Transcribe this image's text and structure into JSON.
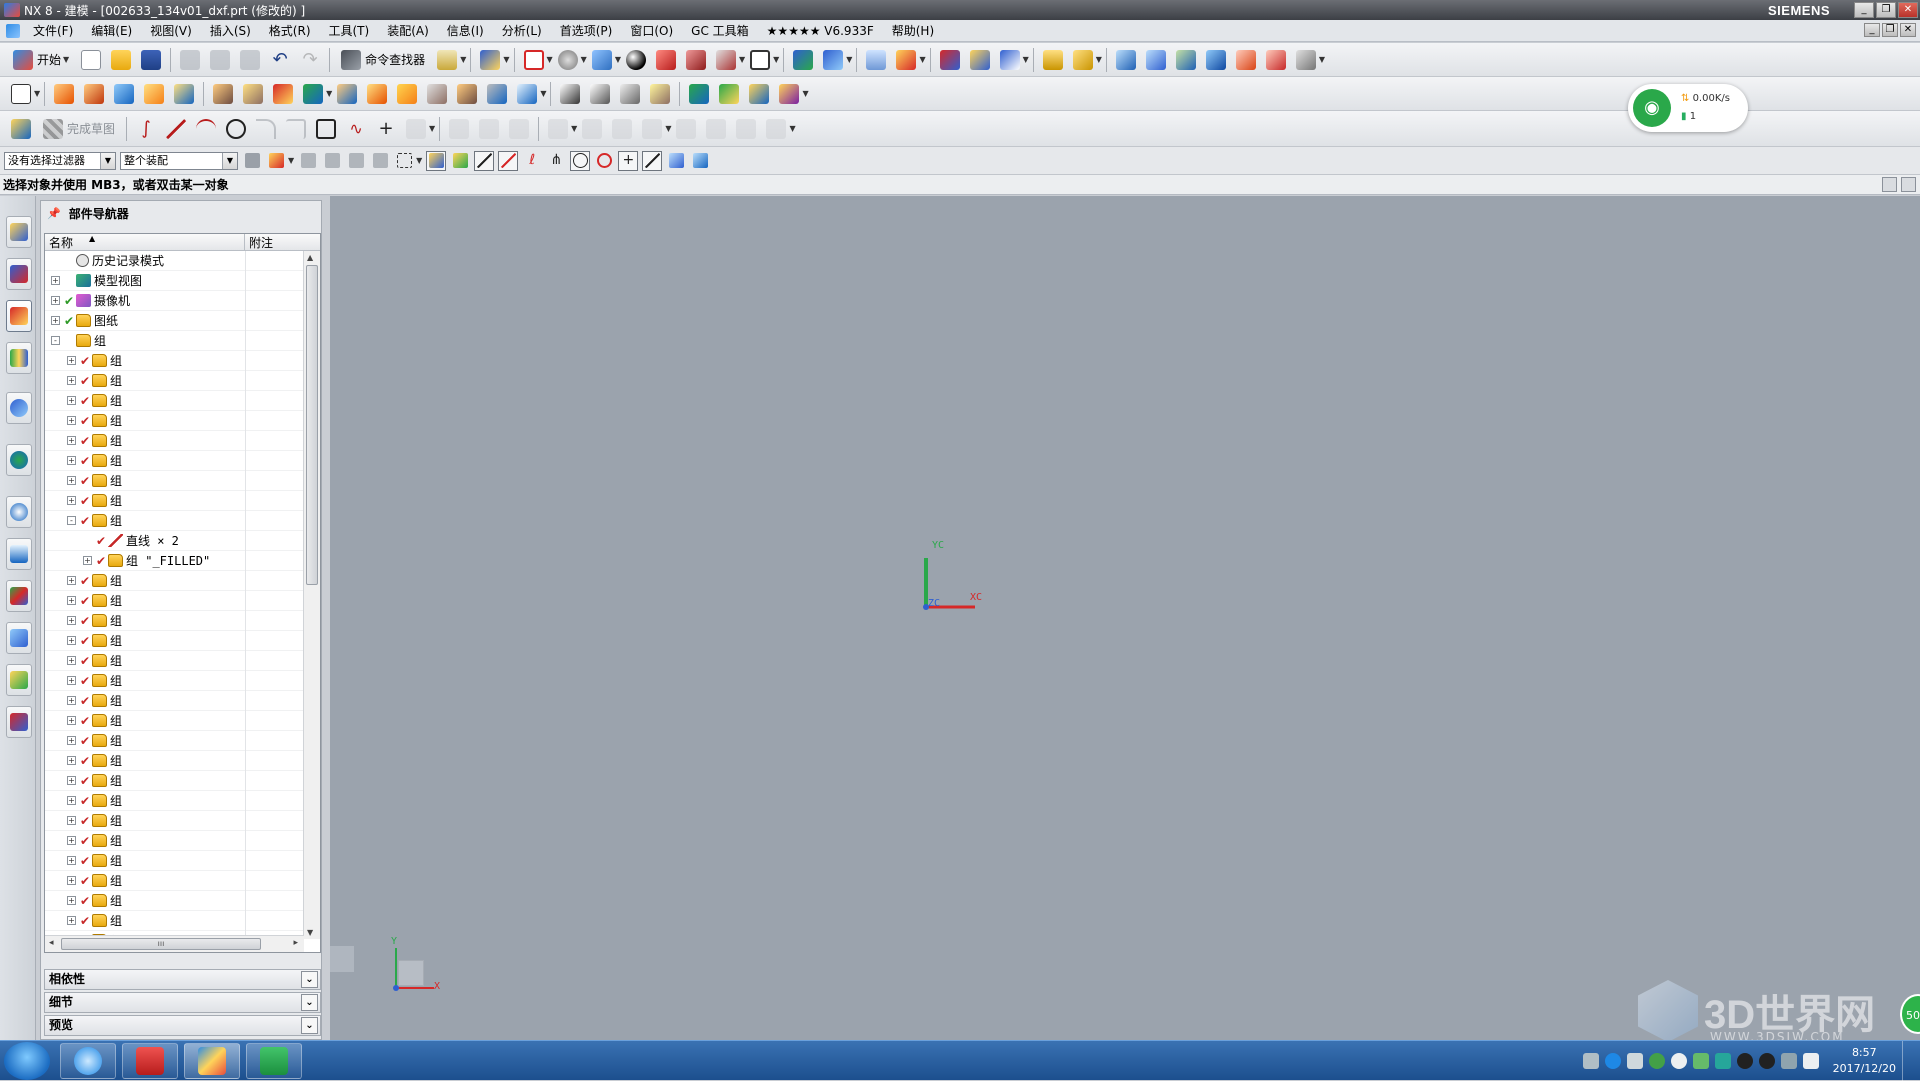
{
  "window": {
    "title": "NX 8 - 建模 - [002633_134v01_dxf.prt (修改的) ]",
    "brand": "SIEMENS",
    "min": "_",
    "restore": "❐",
    "close": "✕"
  },
  "menubar": {
    "items": [
      "文件(F)",
      "编辑(E)",
      "视图(V)",
      "插入(S)",
      "格式(R)",
      "工具(T)",
      "装配(A)",
      "信息(I)",
      "分析(L)",
      "首选项(P)",
      "窗口(O)",
      "GC 工具箱",
      "★★★★★ V6.933F",
      "帮助(H)"
    ]
  },
  "toolbar": {
    "start_label": "开始",
    "command_finder_label": "命令查找器",
    "finish_sketch_label": "完成草图"
  },
  "selection": {
    "filter_value": "没有选择过滤器",
    "scope_value": "整个装配"
  },
  "status": {
    "prompt": "选择对象并使用 MB3，或者双击某一对象"
  },
  "navigator": {
    "title": "部件导航器",
    "col_name": "名称",
    "col_note": "附注",
    "rows": [
      {
        "level": 0,
        "expander": "",
        "check": "",
        "icon": "clock",
        "label": "历史记录模式"
      },
      {
        "level": 0,
        "expander": "+",
        "check": "",
        "icon": "modelview",
        "label": "模型视图"
      },
      {
        "level": 0,
        "expander": "+",
        "check": "✔",
        "icon": "camera",
        "label": "摄像机"
      },
      {
        "level": 0,
        "expander": "+",
        "check": "✔",
        "icon": "folder",
        "label": "图纸"
      },
      {
        "level": 0,
        "expander": "-",
        "check": "",
        "icon": "folder",
        "label": "组"
      },
      {
        "level": 1,
        "expander": "+",
        "check": "✔",
        "icon": "folder",
        "label": "组"
      },
      {
        "level": 1,
        "expander": "+",
        "check": "✔",
        "icon": "folder",
        "label": "组"
      },
      {
        "level": 1,
        "expander": "+",
        "check": "✔",
        "icon": "folder",
        "label": "组"
      },
      {
        "level": 1,
        "expander": "+",
        "check": "✔",
        "icon": "folder",
        "label": "组"
      },
      {
        "level": 1,
        "expander": "+",
        "check": "✔",
        "icon": "folder",
        "label": "组"
      },
      {
        "level": 1,
        "expander": "+",
        "check": "✔",
        "icon": "folder",
        "label": "组"
      },
      {
        "level": 1,
        "expander": "+",
        "check": "✔",
        "icon": "folder",
        "label": "组"
      },
      {
        "level": 1,
        "expander": "+",
        "check": "✔",
        "icon": "folder",
        "label": "组"
      },
      {
        "level": 1,
        "expander": "-",
        "check": "✔",
        "icon": "folder",
        "label": "组"
      },
      {
        "level": 2,
        "expander": "",
        "check": "✔",
        "icon": "line",
        "label": "直线 × 2"
      },
      {
        "level": 2,
        "expander": "+",
        "check": "✔",
        "icon": "folder",
        "label": "组 \"_FILLED\""
      },
      {
        "level": 1,
        "expander": "+",
        "check": "✔",
        "icon": "folder",
        "label": "组"
      },
      {
        "level": 1,
        "expander": "+",
        "check": "✔",
        "icon": "folder",
        "label": "组"
      },
      {
        "level": 1,
        "expander": "+",
        "check": "✔",
        "icon": "folder",
        "label": "组"
      },
      {
        "level": 1,
        "expander": "+",
        "check": "✔",
        "icon": "folder",
        "label": "组"
      },
      {
        "level": 1,
        "expander": "+",
        "check": "✔",
        "icon": "folder",
        "label": "组"
      },
      {
        "level": 1,
        "expander": "+",
        "check": "✔",
        "icon": "folder",
        "label": "组"
      },
      {
        "level": 1,
        "expander": "+",
        "check": "✔",
        "icon": "folder",
        "label": "组"
      },
      {
        "level": 1,
        "expander": "+",
        "check": "✔",
        "icon": "folder",
        "label": "组"
      },
      {
        "level": 1,
        "expander": "+",
        "check": "✔",
        "icon": "folder",
        "label": "组"
      },
      {
        "level": 1,
        "expander": "+",
        "check": "✔",
        "icon": "folder",
        "label": "组"
      },
      {
        "level": 1,
        "expander": "+",
        "check": "✔",
        "icon": "folder",
        "label": "组"
      },
      {
        "level": 1,
        "expander": "+",
        "check": "✔",
        "icon": "folder",
        "label": "组"
      },
      {
        "level": 1,
        "expander": "+",
        "check": "✔",
        "icon": "folder",
        "label": "组"
      },
      {
        "level": 1,
        "expander": "+",
        "check": "✔",
        "icon": "folder",
        "label": "组"
      },
      {
        "level": 1,
        "expander": "+",
        "check": "✔",
        "icon": "folder",
        "label": "组"
      },
      {
        "level": 1,
        "expander": "+",
        "check": "✔",
        "icon": "folder",
        "label": "组"
      },
      {
        "level": 1,
        "expander": "+",
        "check": "✔",
        "icon": "folder",
        "label": "组"
      },
      {
        "level": 1,
        "expander": "+",
        "check": "✔",
        "icon": "folder",
        "label": "组"
      },
      {
        "level": 1,
        "expander": "+",
        "check": "✔",
        "icon": "folder",
        "label": "组"
      }
    ],
    "panels": [
      "相依性",
      "细节",
      "预览"
    ]
  },
  "graphics": {
    "wcs": {
      "yc": "YC",
      "xc": "XC",
      "zc": "ZC"
    },
    "triad": {
      "y": "Y",
      "x": "X"
    }
  },
  "netwidget": {
    "speed": "0.00K/s",
    "count": "1"
  },
  "watermark": {
    "brand": "3D世界网",
    "url": "WWW.3DSJW.COM"
  },
  "badge": "50",
  "taskbar": {
    "time": "8:57",
    "date": "2017/12/20"
  },
  "colors": {
    "graphics_bg": "#9ba3ad",
    "axis_x": "#d62828",
    "axis_y": "#2aa84a",
    "axis_z": "#2f5fd0"
  }
}
